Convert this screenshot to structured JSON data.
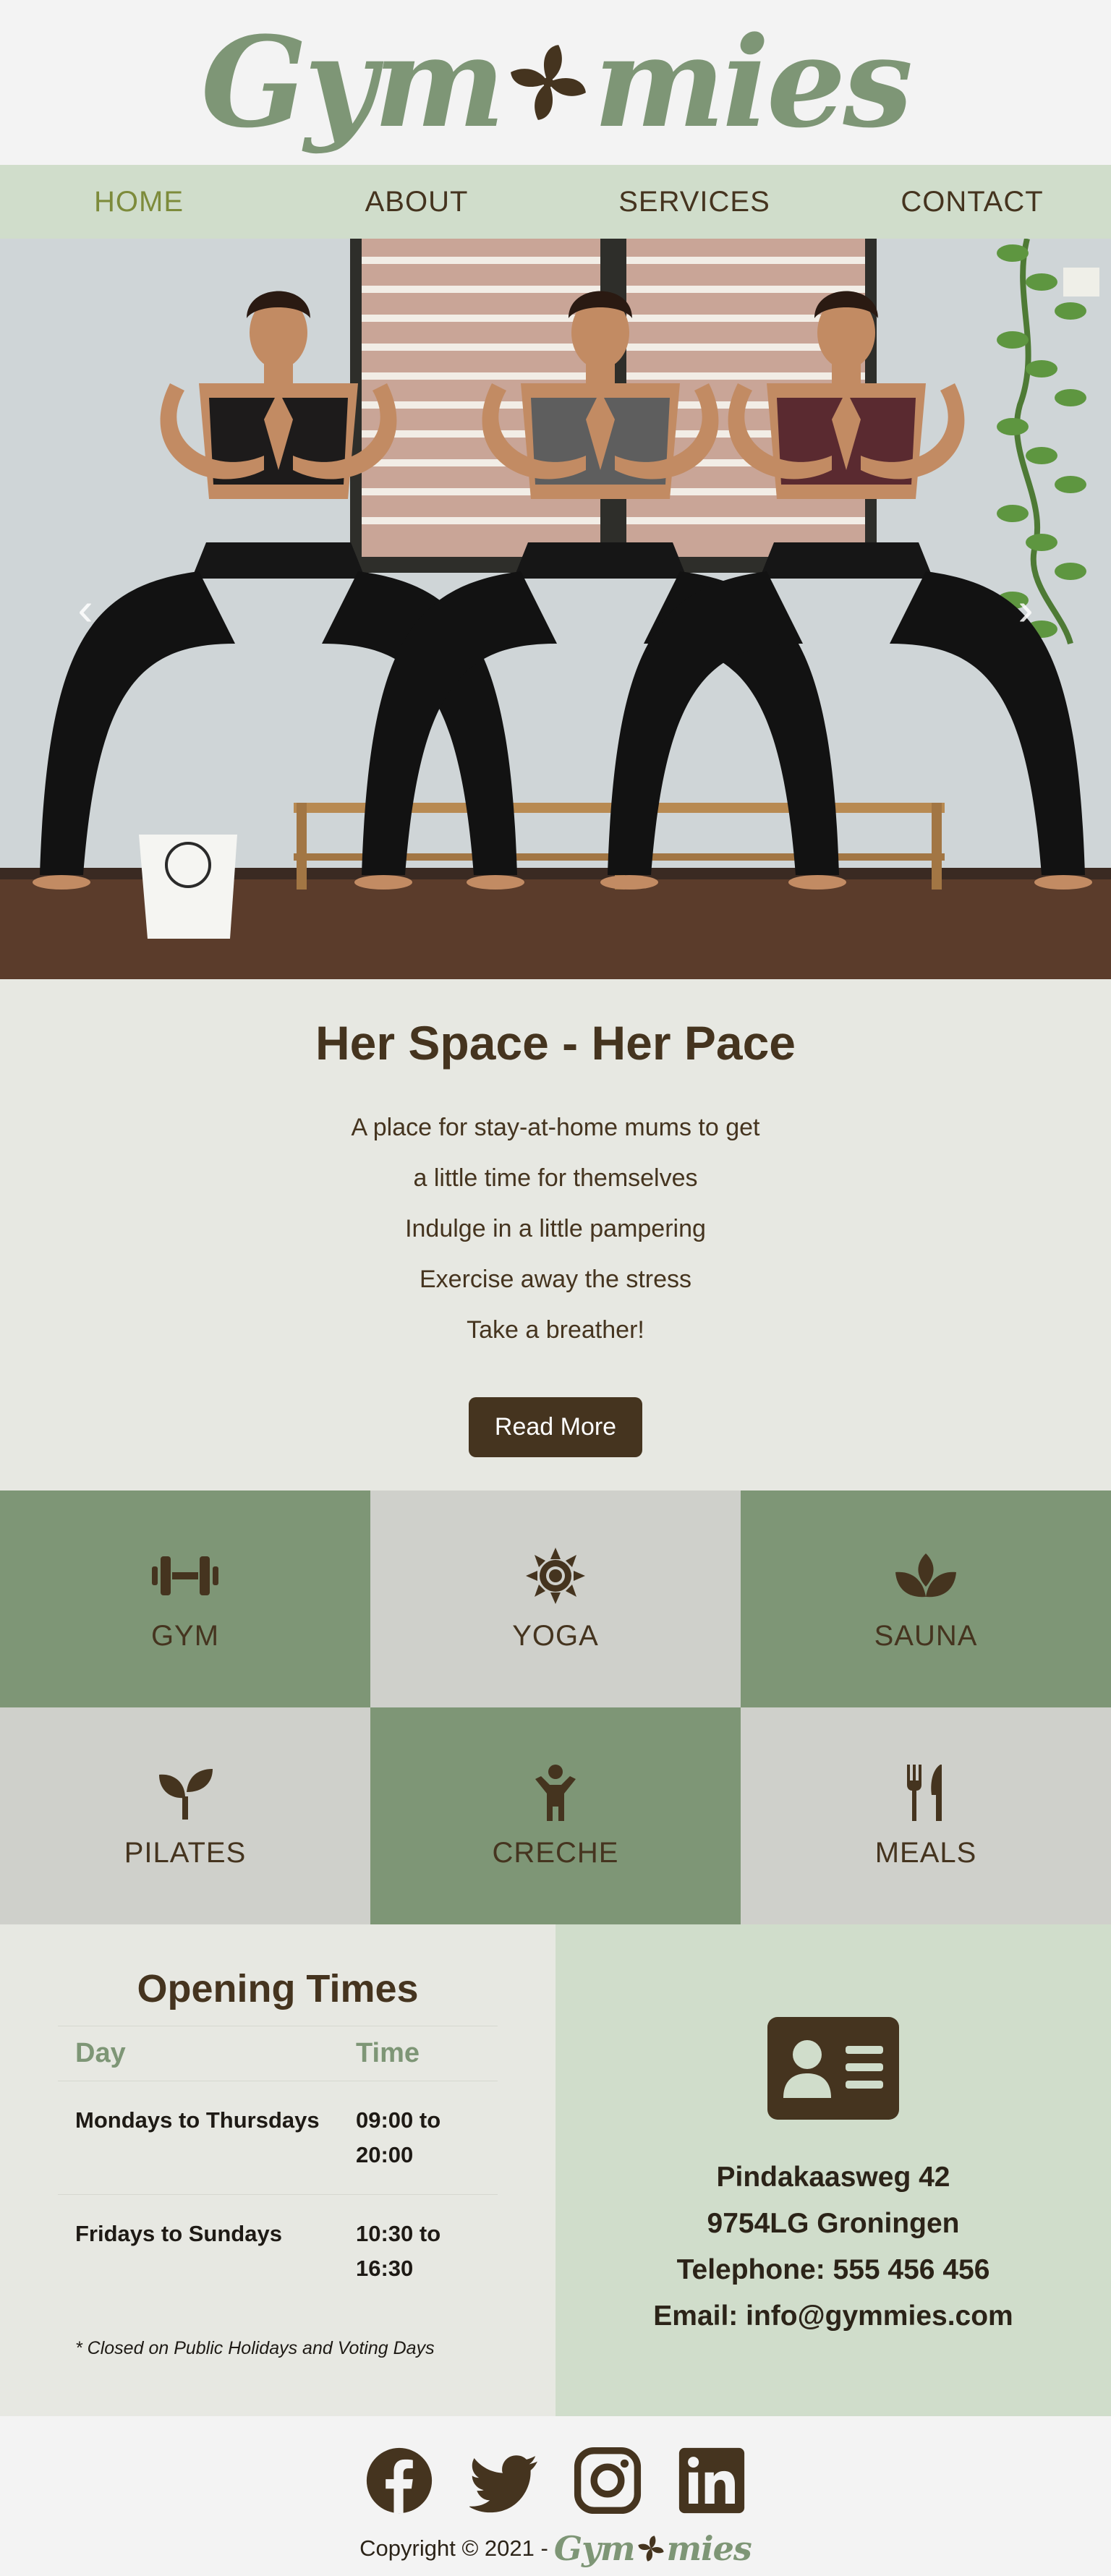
{
  "brand": {
    "logo_left": "Gym",
    "logo_right": "mies",
    "accent": "#7e9676",
    "dark": "#45341f"
  },
  "nav": {
    "items": [
      "HOME",
      "ABOUT",
      "SERVICES",
      "CONTACT"
    ],
    "active": "HOME"
  },
  "hero": {
    "prev_icon": "chevron-left-icon",
    "next_icon": "chevron-right-icon",
    "prev": "‹",
    "next": "›"
  },
  "intro": {
    "title": "Her Space - Her Pace",
    "lines": [
      "A place for stay-at-home mums to get",
      "a little time for themselves",
      "Indulge in a little pampering",
      "Exercise away the stress",
      "Take a breather!"
    ],
    "button": "Read More"
  },
  "services": [
    {
      "label": "GYM",
      "icon": "dumbbell-icon"
    },
    {
      "label": "YOGA",
      "icon": "sun-icon"
    },
    {
      "label": "SAUNA",
      "icon": "spa-icon"
    },
    {
      "label": "PILATES",
      "icon": "seedling-icon"
    },
    {
      "label": "CRECHE",
      "icon": "child-icon"
    },
    {
      "label": "MEALS",
      "icon": "utensils-icon"
    }
  ],
  "hours": {
    "title": "Opening Times",
    "col_day": "Day",
    "col_time": "Time",
    "rows": [
      {
        "day": "Mondays to Thursdays",
        "time": "09:00 to 20:00"
      },
      {
        "day": "Fridays to Sundays",
        "time": "10:30 to 16:30"
      }
    ],
    "note": "* Closed on Public Holidays and Voting Days"
  },
  "contact": {
    "icon": "address-card-icon",
    "address1": "Pindakaasweg 42",
    "address2": "9754LG Groningen",
    "telephone": "Telephone: 555 456 456",
    "email": "Email: info@gymmies.com"
  },
  "footer": {
    "socials": [
      "facebook-icon",
      "twitter-icon",
      "instagram-icon",
      "linkedin-icon"
    ],
    "copyright": "Copyright © 2021 -",
    "logo_left": "Gym",
    "logo_right": "mies"
  }
}
